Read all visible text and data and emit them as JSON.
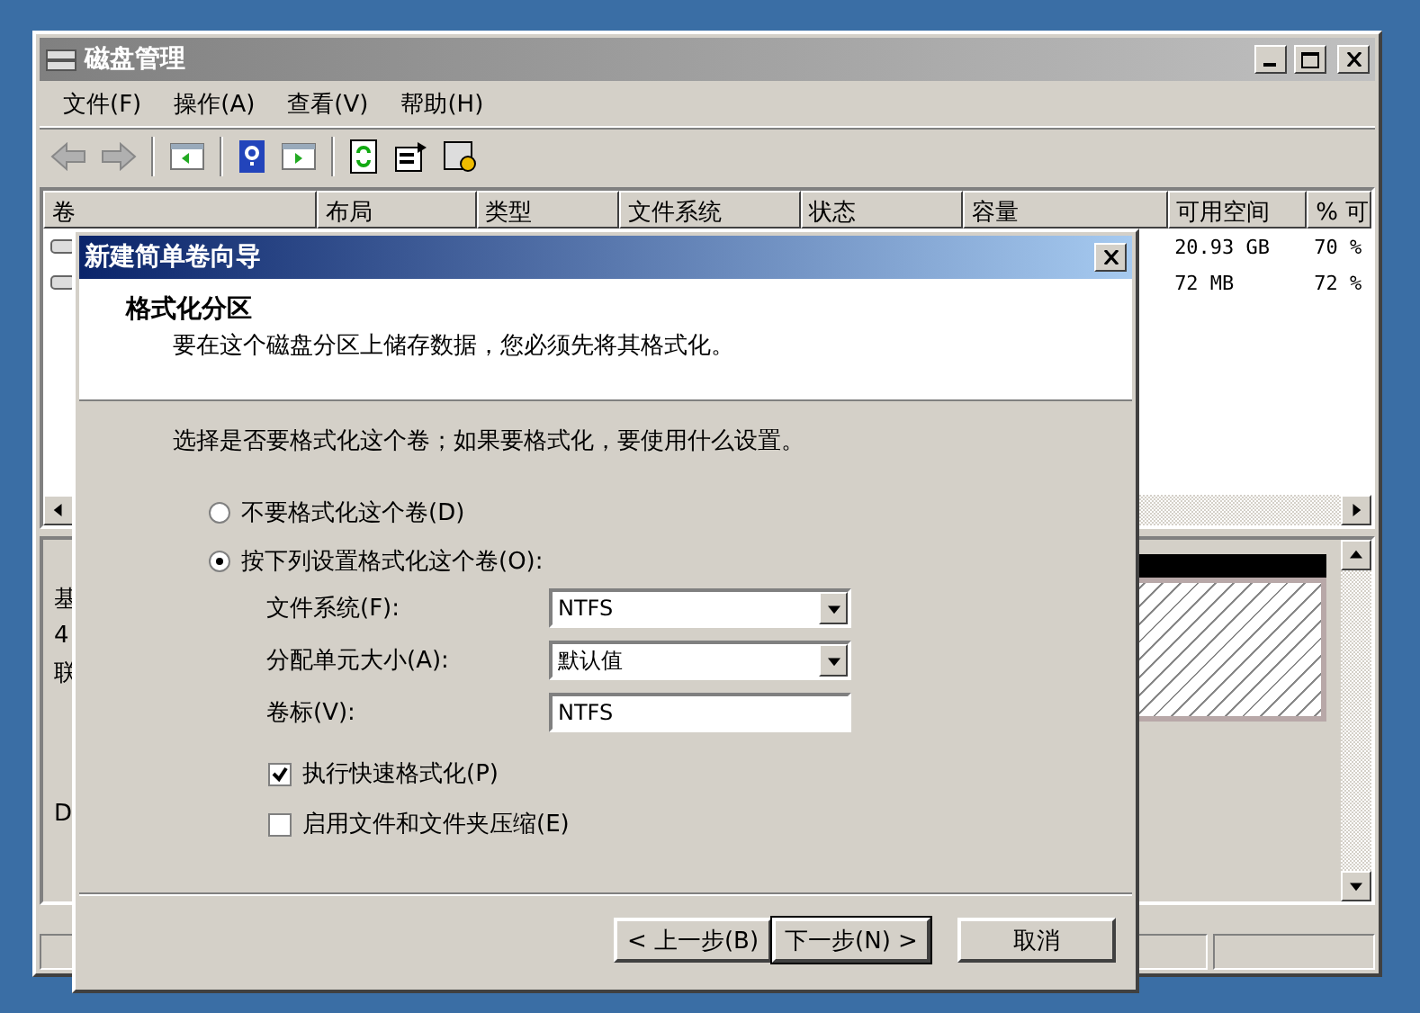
{
  "window": {
    "title": "磁盘管理",
    "active": false
  },
  "menu": [
    {
      "label": "文件(F)"
    },
    {
      "label": "操作(A)"
    },
    {
      "label": "查看(V)"
    },
    {
      "label": "帮助(H)"
    }
  ],
  "table": {
    "columns": [
      "卷",
      "布局",
      "类型",
      "文件系统",
      "状态",
      "容量",
      "可用空间",
      "% 可"
    ],
    "rows": [
      {
        "free": "20.93 GB",
        "percent": "70 %"
      },
      {
        "free": "72 MB",
        "percent": "72 %"
      }
    ]
  },
  "disk_pane": {
    "fragments": [
      "基",
      "4",
      "联",
      "D"
    ]
  },
  "dialog": {
    "title": "新建简单卷向导",
    "heading": "格式化分区",
    "subheading": "要在这个磁盘分区上储存数据，您必须先将其格式化。",
    "prompt": "选择是否要格式化这个卷；如果要格式化，要使用什么设置。",
    "options": [
      {
        "label": "不要格式化这个卷(D)",
        "selected": false
      },
      {
        "label": "按下列设置格式化这个卷(O):",
        "selected": true
      }
    ],
    "fields": [
      {
        "kind": "select",
        "label": "文件系统(F):",
        "value": "NTFS"
      },
      {
        "kind": "select",
        "label": "分配单元大小(A):",
        "value": "默认值"
      },
      {
        "kind": "text",
        "label": "卷标(V):",
        "value": "NTFS"
      }
    ],
    "checks": [
      {
        "label": "执行快速格式化(P)",
        "checked": true
      },
      {
        "label": "启用文件和文件夹压缩(E)",
        "checked": false
      }
    ],
    "buttons": [
      {
        "label": "< 上一步(B)",
        "default": false
      },
      {
        "label": "下一步(N) >",
        "default": true
      },
      {
        "label": "取消",
        "default": false
      }
    ]
  }
}
